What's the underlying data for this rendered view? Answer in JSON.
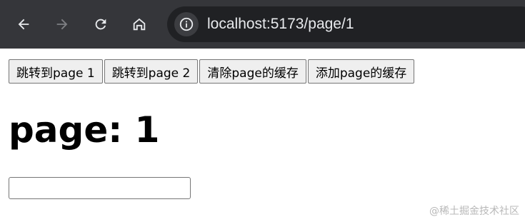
{
  "browser": {
    "url": "localhost:5173/page/1",
    "colors": {
      "toolbar": "#35363a",
      "omnibox": "#202124",
      "icon_active": "#e8eaed",
      "icon_disabled": "#7e7f83"
    },
    "icons": [
      "back-arrow-icon",
      "forward-arrow-icon",
      "reload-icon",
      "home-icon",
      "info-icon"
    ]
  },
  "page": {
    "buttons": [
      {
        "label": "跳转到page 1"
      },
      {
        "label": "跳转到page 2"
      },
      {
        "label": "清除page的缓存"
      },
      {
        "label": "添加page的缓存"
      }
    ],
    "heading": "page: 1",
    "input_value": "",
    "watermark": "@稀土掘金技术社区"
  }
}
